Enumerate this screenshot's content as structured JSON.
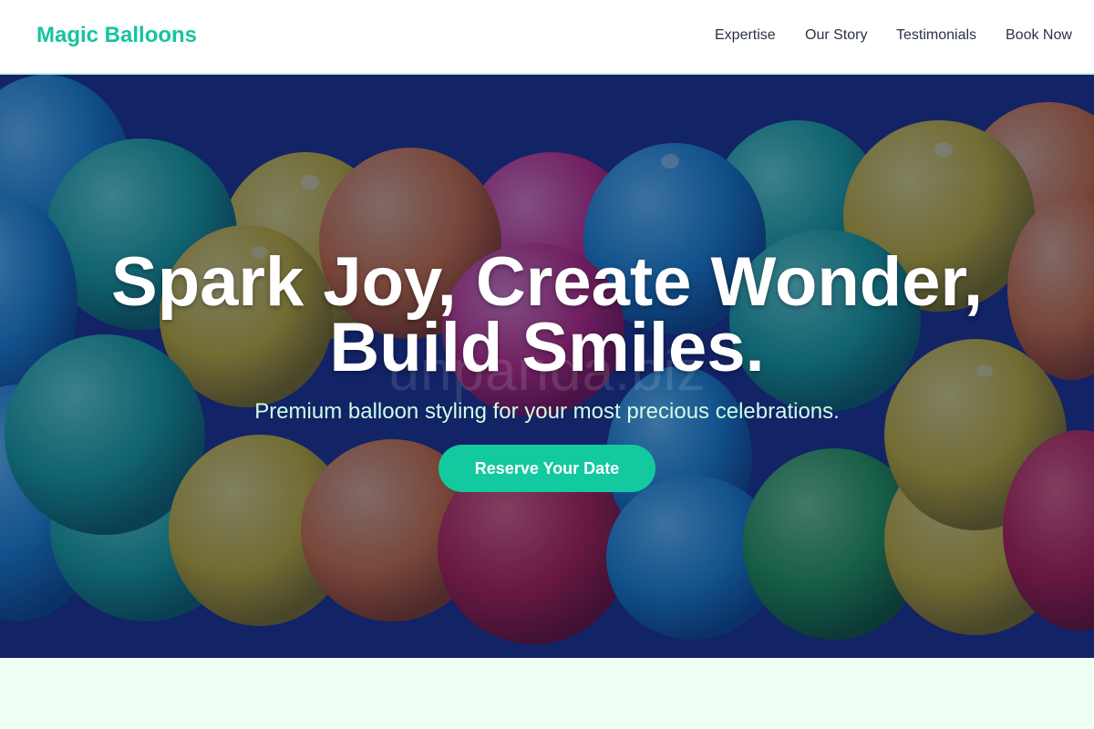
{
  "brand": {
    "name": "Magic Balloons",
    "accent_color": "#14c4a0"
  },
  "nav": {
    "items": [
      {
        "label": "Expertise"
      },
      {
        "label": "Our Story"
      },
      {
        "label": "Testimonials"
      },
      {
        "label": "Book Now"
      }
    ]
  },
  "hero": {
    "title": "Spark Joy, Create Wonder, Build Smiles.",
    "subtitle": "Premium balloon styling for your most precious celebrations.",
    "cta_label": "Reserve Your Date",
    "watermark": "unpanda.biz",
    "background_image": "colorful-balloons-photo"
  }
}
